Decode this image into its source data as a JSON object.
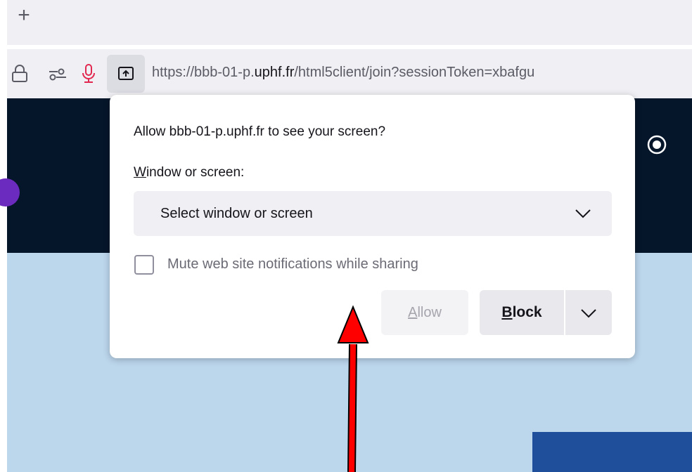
{
  "tabbar": {
    "new_tab_glyph": "+"
  },
  "urlbar": {
    "url_prefix": "https://bbb-01-p.",
    "url_host": "uphf.fr",
    "url_suffix": "/html5client/join?sessionToken=xbafgu",
    "icons": [
      "lock-icon",
      "permissions-icon",
      "microphone-icon",
      "screen-share-icon"
    ]
  },
  "popup": {
    "title": "Allow bbb-01-p.uphf.fr to see your screen?",
    "select_label_accesskey": "W",
    "select_label_rest": "indow or screen:",
    "select_value": "Select window or screen",
    "mute_label": "Mute web site notifications while sharing",
    "mute_checked": false,
    "allow_accesskey": "A",
    "allow_rest": "llow",
    "block_accesskey": "B",
    "block_rest": "lock"
  },
  "colors": {
    "page_dark": "#06162a",
    "page_light": "#bcd6ec",
    "annotation_arrow": "#ff0000",
    "mic_active": "#e22850"
  }
}
